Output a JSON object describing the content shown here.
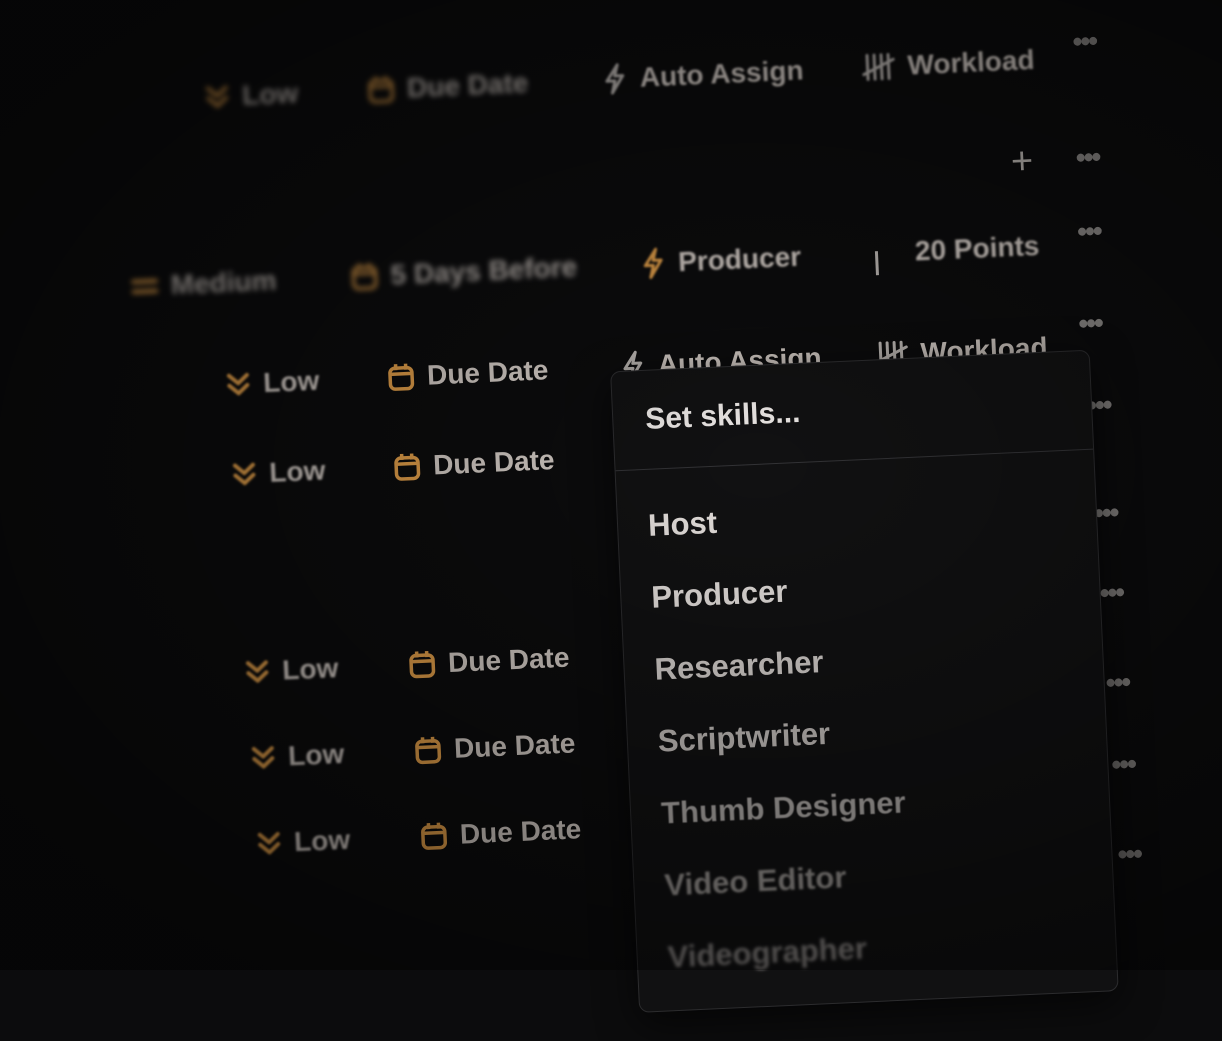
{
  "rows": [
    {
      "priority": "Low",
      "date": "Due Date",
      "assign": "Auto Assign",
      "extra": "Workload"
    },
    {
      "priority": "Medium",
      "date": "5 Days Before",
      "assign": "Producer",
      "extra": "20 Points"
    },
    {
      "priority": "Low",
      "date": "Due Date",
      "assign": "Auto Assign",
      "extra": "Workload"
    },
    {
      "priority": "Low",
      "date": "Due Date"
    },
    {
      "priority": "Low",
      "date": "Due Date"
    },
    {
      "priority": "Low",
      "date": "Due Date"
    },
    {
      "priority": "Low",
      "date": "Due Date"
    }
  ],
  "more_label": "•••",
  "add_label": "+",
  "dropdown": {
    "placeholder": "Set skills...",
    "options": [
      "Host",
      "Producer",
      "Researcher",
      "Scriptwriter",
      "Thumb Designer",
      "Video Editor",
      "Videographer"
    ]
  },
  "colors": {
    "background": "#0c0c0d",
    "text": "#d4ccc6",
    "icon_accent": "#e4a04a",
    "menu_bg": "#111112"
  },
  "icons": {
    "priority_low": "chevrons-down-icon",
    "priority_medium": "equals-icon",
    "date": "calendar-icon",
    "assign": "lightning-icon",
    "workload": "tally-icon",
    "more": "more-horizontal-icon",
    "add": "plus-icon"
  }
}
